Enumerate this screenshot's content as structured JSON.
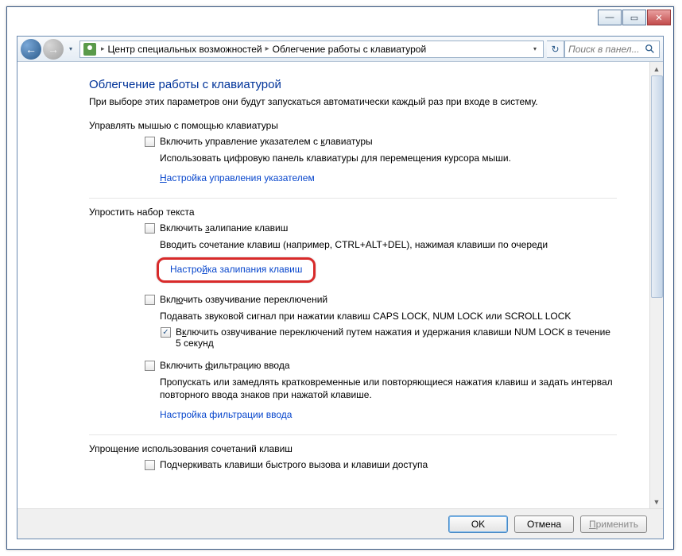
{
  "titlebar": {
    "min": "—",
    "max": "▭",
    "close": "✕"
  },
  "nav": {
    "back": "←",
    "fwd": "→",
    "dd": "▾",
    "breadcrumb1": "Центр специальных возможностей",
    "breadcrumb2": "Облегчение работы с клавиатурой",
    "sep": "▸",
    "refresh": "↻",
    "search_placeholder": "Поиск в панел..."
  },
  "page": {
    "title": "Облегчение работы с клавиатурой",
    "subtitle": "При выборе этих параметров они будут запускаться автоматически каждый раз при входе в систему."
  },
  "s1": {
    "title": "Управлять мышью с помощью клавиатуры",
    "opt1": "Включить управление указателем с клавиатуры",
    "desc1": "Использовать цифровую панель клавиатуры для перемещения курсора мыши.",
    "link1": "Настройка управления указателем"
  },
  "s2": {
    "title": "Упростить набор текста",
    "opt1": "Включить залипание клавиш",
    "desc1": "Вводить сочетание клавиш (например, CTRL+ALT+DEL), нажимая клавиши по очереди",
    "link1": "Настройка залипания клавиш",
    "opt2": "Включить озвучивание переключений",
    "desc2": "Подавать звуковой сигнал при нажатии клавиш CAPS LOCK, NUM LOCK или SCROLL LOCK",
    "opt2b": "Включить озвучивание переключений путем нажатия и удержания клавиши NUM LOCK в течение 5 секунд",
    "opt3": "Включить фильтрацию ввода",
    "desc3": "Пропускать или замедлять кратковременные или повторяющиеся нажатия клавиш и задать интервал повторного ввода знаков при нажатой клавише.",
    "link3": "Настройка фильтрации ввода"
  },
  "s3": {
    "title": "Упрощение использования сочетаний клавиш",
    "opt1": "Подчеркивать клавиши быстрого вызова и клавиши доступа"
  },
  "buttons": {
    "ok": "OK",
    "cancel": "Отмена",
    "apply": "Применить"
  }
}
